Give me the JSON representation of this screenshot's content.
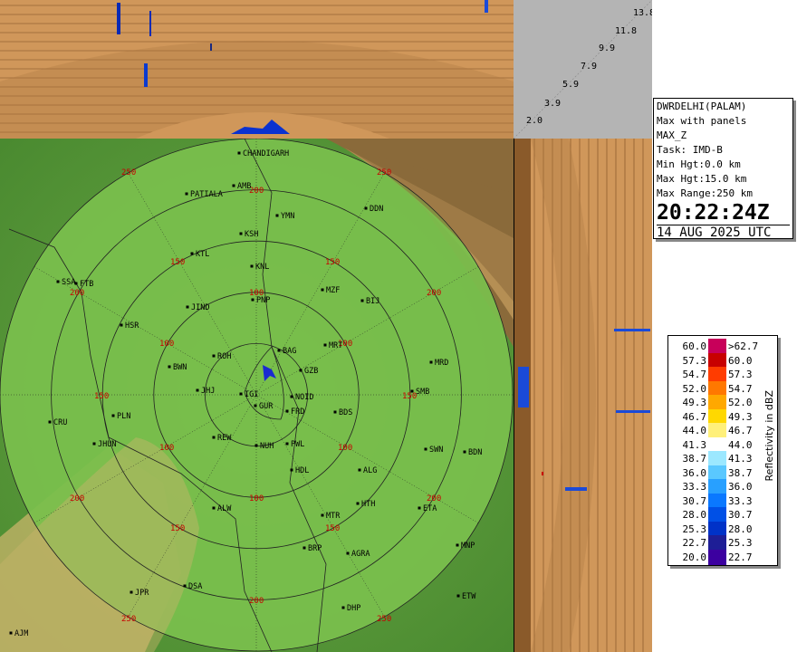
{
  "top_panel": {
    "height_labels": [
      "13.8",
      "11.8",
      "9.9",
      "7.9",
      "5.9",
      "3.9",
      "2.0"
    ]
  },
  "info": {
    "station": "DWRDELHI(PALAM)",
    "product": "Max with panels",
    "field": "MAX_Z",
    "task": "Task: IMD-B",
    "min_hgt": "Min Hgt:0.0 km",
    "max_hgt": "Max Hgt:15.0 km",
    "max_range": "Max Range:250 km",
    "time": "20:22:24Z",
    "date": "14 AUG 2025 UTC"
  },
  "legend": {
    "title": "Reflectivity in dBZ",
    "rows": [
      {
        "lo": "60.0",
        "hi": ">62.7",
        "color": "#c8005a"
      },
      {
        "lo": "57.3",
        "hi": "60.0",
        "color": "#c80000"
      },
      {
        "lo": "54.7",
        "hi": "57.3",
        "color": "#ff3c00"
      },
      {
        "lo": "52.0",
        "hi": "54.7",
        "color": "#ff7800"
      },
      {
        "lo": "49.3",
        "hi": "52.0",
        "color": "#ffa800"
      },
      {
        "lo": "46.7",
        "hi": "49.3",
        "color": "#ffd800"
      },
      {
        "lo": "44.0",
        "hi": "46.7",
        "color": "#fff07a"
      },
      {
        "lo": "41.3",
        "hi": "44.0",
        "color": "#ffffff"
      },
      {
        "lo": "38.7",
        "hi": "41.3",
        "color": "#9ce8ff"
      },
      {
        "lo": "36.0",
        "hi": "38.7",
        "color": "#5ac8ff"
      },
      {
        "lo": "33.3",
        "hi": "36.0",
        "color": "#28a0ff"
      },
      {
        "lo": "30.7",
        "hi": "33.3",
        "color": "#0a78ff"
      },
      {
        "lo": "28.0",
        "hi": "30.7",
        "color": "#0050e6"
      },
      {
        "lo": "25.3",
        "hi": "28.0",
        "color": "#0032c8"
      },
      {
        "lo": "22.7",
        "hi": "25.3",
        "color": "#1e1e96"
      },
      {
        "lo": "20.0",
        "hi": "22.7",
        "color": "#3c00a0"
      }
    ]
  },
  "map": {
    "range_labels": [
      "250",
      "200",
      "150",
      "100"
    ],
    "colors": {
      "coverage": "#7ac04c",
      "terrain": "#5a9a3a",
      "hills": "#c8b46a",
      "mountain": "#8a6a3a",
      "ring": "#222222",
      "label": "#c80000"
    },
    "places": [
      {
        "name": "CHANDIGARH"
      },
      {
        "name": "PATIALA"
      },
      {
        "name": "AMB"
      },
      {
        "name": "DDN"
      },
      {
        "name": "YMN"
      },
      {
        "name": "KSH"
      },
      {
        "name": "KTL"
      },
      {
        "name": "KNL"
      },
      {
        "name": "SSA"
      },
      {
        "name": "FTB"
      },
      {
        "name": "MZF"
      },
      {
        "name": "BIJ"
      },
      {
        "name": "JIND"
      },
      {
        "name": "PNP"
      },
      {
        "name": "HSR"
      },
      {
        "name": "BAG"
      },
      {
        "name": "MRT"
      },
      {
        "name": "ROH"
      },
      {
        "name": "BWN"
      },
      {
        "name": "MRD"
      },
      {
        "name": "GZB"
      },
      {
        "name": "JHJ"
      },
      {
        "name": "IGI"
      },
      {
        "name": "NOID"
      },
      {
        "name": "SMB"
      },
      {
        "name": "GUR"
      },
      {
        "name": "FRD"
      },
      {
        "name": "CRU"
      },
      {
        "name": "PLN"
      },
      {
        "name": "BDS"
      },
      {
        "name": "JHUN"
      },
      {
        "name": "REW"
      },
      {
        "name": "NUH"
      },
      {
        "name": "PWL"
      },
      {
        "name": "SWN"
      },
      {
        "name": "BDN"
      },
      {
        "name": "HDL"
      },
      {
        "name": "ALG"
      },
      {
        "name": "HTH"
      },
      {
        "name": "ALW"
      },
      {
        "name": "ETA"
      },
      {
        "name": "MTR"
      },
      {
        "name": "BRP"
      },
      {
        "name": "AGRA"
      },
      {
        "name": "MNP"
      },
      {
        "name": "JPR"
      },
      {
        "name": "DSA"
      },
      {
        "name": "ETW"
      },
      {
        "name": "DHP"
      },
      {
        "name": "AJM"
      }
    ]
  }
}
